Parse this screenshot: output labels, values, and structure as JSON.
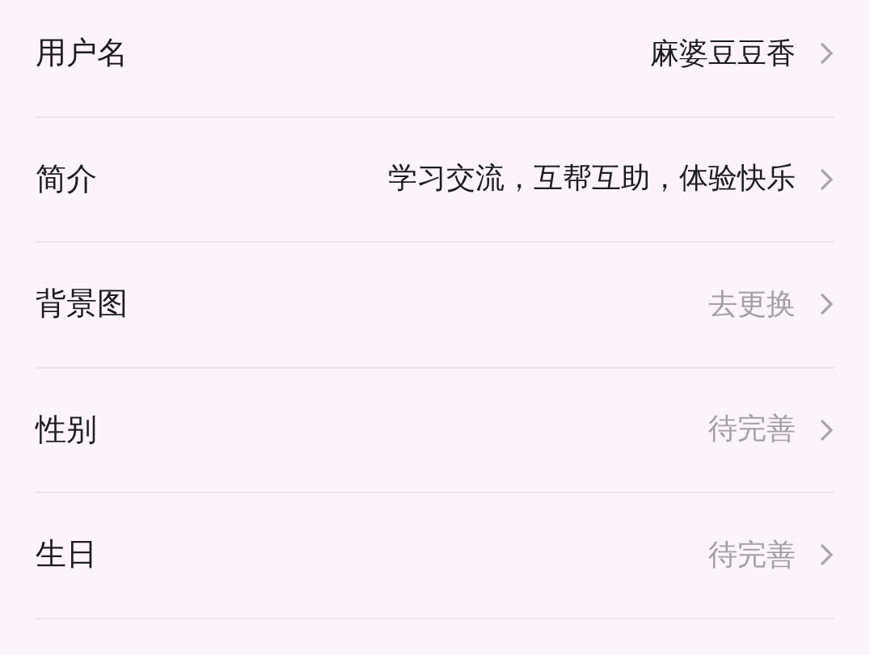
{
  "rows": [
    {
      "label": "用户名",
      "value": "麻婆豆豆香",
      "filled": true
    },
    {
      "label": "简介",
      "value": "学习交流，互帮互助，体验快乐",
      "filled": true
    },
    {
      "label": "背景图",
      "value": "去更换",
      "filled": false
    },
    {
      "label": "性别",
      "value": "待完善",
      "filled": false
    },
    {
      "label": "生日",
      "value": "待完善",
      "filled": false
    }
  ]
}
